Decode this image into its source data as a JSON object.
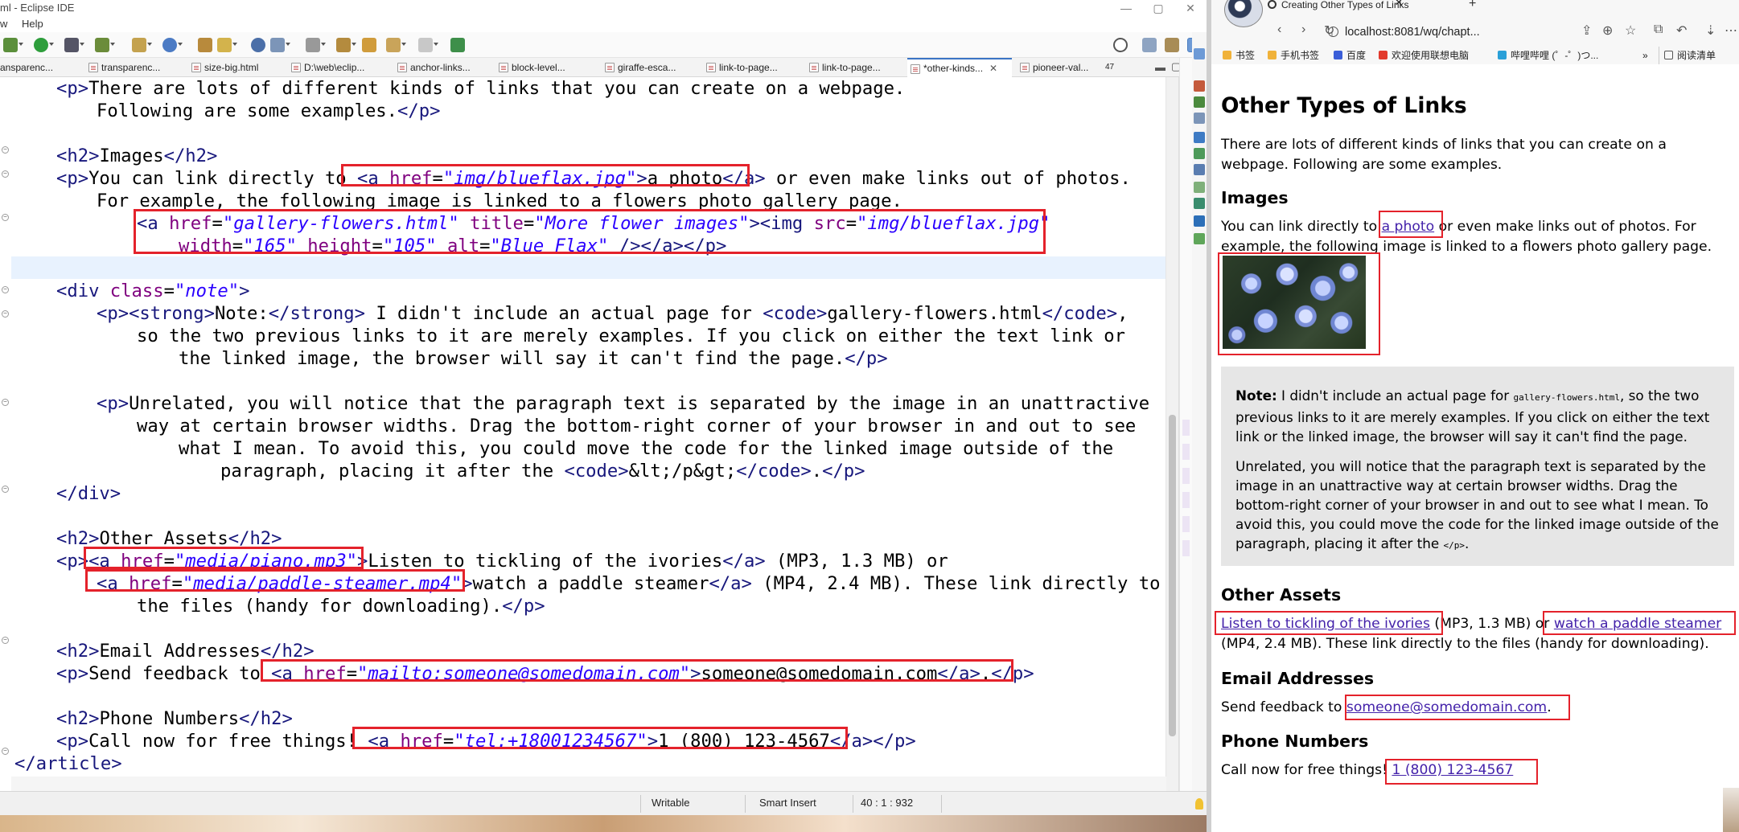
{
  "eclipse": {
    "title": "ml - Eclipse IDE",
    "menu": [
      "w",
      "Help"
    ],
    "tabs": [
      {
        "label": "ansparenc..."
      },
      {
        "label": "transparenc..."
      },
      {
        "label": "size-big.html"
      },
      {
        "label": "D:\\web\\eclip..."
      },
      {
        "label": "anchor-links..."
      },
      {
        "label": "block-level..."
      },
      {
        "label": "giraffe-esca..."
      },
      {
        "label": "link-to-page..."
      },
      {
        "label": "link-to-page..."
      },
      {
        "label": "*other-kinds..."
      },
      {
        "label": "pioneer-val..."
      },
      {
        "label": "47"
      }
    ],
    "status": {
      "mode": "Writable",
      "insert": "Smart Insert",
      "position": "40 : 1 : 932"
    },
    "code": {
      "l1": {
        "t1": "<p>",
        "t2": "There are lots of different kinds of links that you can create on a webpage."
      },
      "l2": {
        "t1": "Following are some examples.",
        "t2": "</p>"
      },
      "l4": {
        "t1": "<h2>",
        "t2": "Images",
        "t3": "</h2>"
      },
      "l5": {
        "t1": "<p>",
        "t2": "You can link directly to ",
        "t3": "<a ",
        "t4": "href",
        "t5": "=",
        "t6": "\"img/blueflax.jpg\"",
        "t7": ">",
        "t8": "a photo",
        "t9": "</a>",
        "t10": " or even make links out of photos."
      },
      "l6": {
        "t1": "For example, the following image is linked to a flowers photo gallery page."
      },
      "l7": {
        "t1": "<a ",
        "t2": "href",
        "t3": "=",
        "t4": "\"gallery-flowers.html\"",
        "t5": " title",
        "t6": "=",
        "t7": "\"More flower images\"",
        "t8": "><img ",
        "t9": "src",
        "t10": "=",
        "t11": "\"img/blueflax.jpg\""
      },
      "l8": {
        "t1": "width",
        "t2": "=",
        "t3": "\"165\"",
        "t4": " height",
        "t5": "=",
        "t6": "\"105\"",
        "t7": " alt",
        "t8": "=",
        "t9": "\"Blue Flax\"",
        "t10": " /></a></p>"
      },
      "l10": {
        "t1": "<div ",
        "t2": "class",
        "t3": "=",
        "t4": "\"note\"",
        "t5": ">"
      },
      "l11": {
        "t1": "<p><strong>",
        "t2": "Note:",
        "t3": "</strong>",
        "t4": " I didn't include an actual page for ",
        "t5": "<code>",
        "t6": "gallery-flowers.html",
        "t7": "</code>",
        "t8": ","
      },
      "l12": {
        "t1": "so the two previous links to it are merely examples. If you click on either the text link or"
      },
      "l13": {
        "t1": "the linked image, the browser will say it can't find the page.",
        "t2": "</p>"
      },
      "l15": {
        "t1": "<p>",
        "t2": "Unrelated, you will notice that the paragraph text is separated by the image in an unattractive"
      },
      "l16": {
        "t1": "way at certain browser widths. Drag the bottom-right corner of your browser in and out to see"
      },
      "l17": {
        "t1": "what I mean. To avoid this, you could move the code for the linked image outside of the"
      },
      "l18": {
        "t1": "paragraph, placing it after the ",
        "t2": "<code>",
        "t3": "&lt;/p&gt;",
        "t4": "</code>",
        "t5": ".",
        "t6": "</p>"
      },
      "l19": {
        "t1": "</div>"
      },
      "l21": {
        "t1": "<h2>",
        "t2": "Other Assets",
        "t3": "</h2>"
      },
      "l22": {
        "t1": "<p>",
        "t2": "<a ",
        "t3": "href",
        "t4": "=",
        "t5": "\"media/piano.mp3\"",
        "t6": ">",
        "t7": "Listen to tickling of the ivories",
        "t8": "</a>",
        "t9": " (MP3, 1.3 MB) or"
      },
      "l23": {
        "t1": "<a ",
        "t2": "href",
        "t3": "=",
        "t4": "\"media/paddle-steamer.mp4\"",
        "t5": ">",
        "t6": "watch a paddle steamer",
        "t7": "</a>",
        "t8": " (MP4, 2.4 MB). These link directly to"
      },
      "l24": {
        "t1": "the files (handy for downloading).",
        "t2": "</p>"
      },
      "l26": {
        "t1": "<h2>",
        "t2": "Email Addresses",
        "t3": "</h2>"
      },
      "l27": {
        "t1": "<p>",
        "t2": "Send feedback to ",
        "t3": "<a ",
        "t4": "href",
        "t5": "=",
        "t6": "\"mailto:someone@somedomain.com\"",
        "t7": ">",
        "t8": "someone@somedomain.com",
        "t9": "</a>",
        "t10": ".",
        "t11": "</p>"
      },
      "l29": {
        "t1": "<h2>",
        "t2": "Phone Numbers",
        "t3": "</h2>"
      },
      "l30": {
        "t1": "<p>",
        "t2": "Call now for free things! ",
        "t3": "<a ",
        "t4": "href",
        "t5": "=",
        "t6": "\"tel:+18001234567\"",
        "t7": ">",
        "t8": "1 (800) 123-4567",
        "t9": "</a>",
        "t10": "</p>"
      },
      "l31": {
        "t1": "</article>"
      }
    }
  },
  "browser": {
    "tab_title": "Creating Other Types of Links",
    "url": "localhost:8081/wq/chapt...",
    "bookmarks": [
      "书签",
      "手机书签",
      "百度",
      "欢迎使用联想电脑",
      "哔哩哔哩 (゜-゜)つ...",
      "»",
      "阅读清单"
    ],
    "page": {
      "h1": "Other Types of Links",
      "intro": "There are lots of different kinds of links that you can create on a webpage. Following are some examples.",
      "h2_images": "Images",
      "images_p1": "You can link directly to ",
      "images_link": "a photo",
      "images_p2": " or even make links out of photos. For example, the following image is linked to a flowers photo gallery page.",
      "note_label": "Note:",
      "note_p1": " I didn't include an actual page for ",
      "note_code": "gallery-flowers.html",
      "note_p2": ", so the two previous links to it are merely examples. If you click on either the text link or the linked image, the browser will say it can't find the page.",
      "unrelated_p1": "Unrelated, you will notice that the paragraph text is separated by the image in an unattractive way at certain browser widths. Drag the bottom-right corner of your browser in and out to see what I mean. To avoid this, you could move the code for the linked image outside of the paragraph, placing it after the ",
      "unrelated_code": "</p>",
      "unrelated_p2": ".",
      "h2_assets": "Other Assets",
      "assets_link1": "Listen to tickling of the ivories",
      "assets_mid": " (MP3, 1.3 MB) or ",
      "assets_link2": "watch a paddle steamer",
      "assets_end": " (MP4, 2.4 MB). These link directly to the files (handy for downloading).",
      "h2_email": "Email Addresses",
      "email_pre": "Send feedback to ",
      "email_link": "someone@somedomain.com",
      "email_post": ".",
      "h2_phone": "Phone Numbers",
      "phone_pre": "Call now for free things! ",
      "phone_link": "1 (800) 123-4567"
    }
  },
  "colors": {
    "tag": "#17177c",
    "attr_name": "#7f007f",
    "attr_value": "#2a00ff",
    "highlight": "#e4222b",
    "link": "#4422aa"
  }
}
